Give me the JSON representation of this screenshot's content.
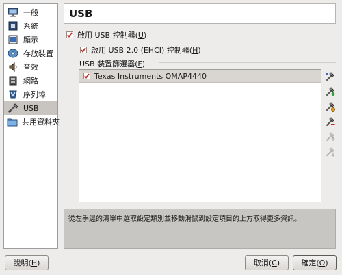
{
  "sidebar": {
    "items": [
      {
        "label": "一般",
        "icon": "monitor-icon"
      },
      {
        "label": "系統",
        "icon": "chip-icon"
      },
      {
        "label": "顯示",
        "icon": "display-icon"
      },
      {
        "label": "存放裝置",
        "icon": "disc-icon"
      },
      {
        "label": "音效",
        "icon": "speaker-icon"
      },
      {
        "label": "網路",
        "icon": "network-icon"
      },
      {
        "label": "序列埠",
        "icon": "serial-port-icon"
      },
      {
        "label": "USB",
        "icon": "usb-icon",
        "active": true
      },
      {
        "label": "共用資料夾",
        "icon": "folder-icon"
      }
    ]
  },
  "header": {
    "title": "USB"
  },
  "usb": {
    "enable_controller": {
      "text": "啟用 USB 控制器(",
      "key": "U",
      "suffix": ")",
      "checked": true
    },
    "enable_ehci": {
      "text": "啟用 USB 2.0 (EHCI) 控制器(",
      "key": "H",
      "suffix": ")",
      "checked": true
    },
    "filters_label": {
      "text": "USB 裝置篩選器(",
      "key": "F",
      "suffix": ")"
    },
    "filters": [
      {
        "name": "Texas Instruments OMAP4440",
        "checked": true
      }
    ]
  },
  "toolbar": {
    "icons": [
      "add-filter-icon",
      "add-from-device-icon",
      "edit-filter-icon",
      "remove-filter-icon",
      "move-up-icon",
      "move-down-icon"
    ]
  },
  "info": {
    "text": "從左手邊的清單中選取設定類別並移動滑鼠到設定項目的上方取得更多資訊。"
  },
  "buttons": {
    "help": {
      "text": "說明(",
      "key": "H",
      "suffix": ")"
    },
    "cancel": {
      "text": "取消(",
      "key": "C",
      "suffix": ")"
    },
    "ok": {
      "text": "確定(",
      "key": "O",
      "suffix": ")"
    }
  },
  "colors": {
    "checkbox_mark": "#c0261c",
    "active_item": "#c8c5c0"
  }
}
